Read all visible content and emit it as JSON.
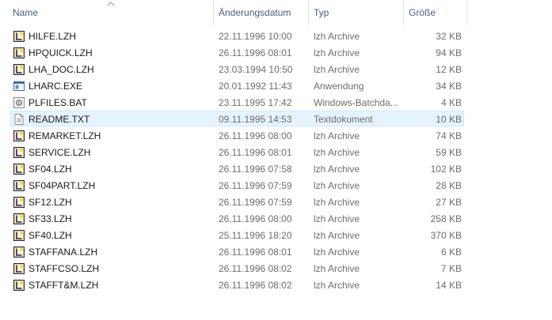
{
  "columns": {
    "name": "Name",
    "date": "Änderungsdatum",
    "type": "Typ",
    "size": "Größe"
  },
  "files": [
    {
      "name": "HILFE.LZH",
      "date": "22.11.1996 10:00",
      "type": "lzh Archive",
      "size": "32 KB",
      "icon": "archive-icon"
    },
    {
      "name": "HPQUICK.LZH",
      "date": "26.11.1996 08:01",
      "type": "lzh Archive",
      "size": "94 KB",
      "icon": "archive-icon"
    },
    {
      "name": "LHA_DOC.LZH",
      "date": "23.03.1994 10:50",
      "type": "lzh Archive",
      "size": "12 KB",
      "icon": "archive-icon"
    },
    {
      "name": "LHARC.EXE",
      "date": "20.01.1992 11:43",
      "type": "Anwendung",
      "size": "34 KB",
      "icon": "application-icon"
    },
    {
      "name": "PLFILES.BAT",
      "date": "23.11.1995 17:42",
      "type": "Windows-Batchda...",
      "size": "4 KB",
      "icon": "batch-file-icon"
    },
    {
      "name": "README.TXT",
      "date": "09.11.1995 14:53",
      "type": "Textdokument",
      "size": "10 KB",
      "icon": "text-document-icon",
      "selected": true
    },
    {
      "name": "REMARKET.LZH",
      "date": "26.11.1996 08:00",
      "type": "lzh Archive",
      "size": "74 KB",
      "icon": "archive-icon"
    },
    {
      "name": "SERVICE.LZH",
      "date": "26.11.1996 08:01",
      "type": "lzh Archive",
      "size": "59 KB",
      "icon": "archive-icon"
    },
    {
      "name": "SF04.LZH",
      "date": "26.11.1996 07:58",
      "type": "lzh Archive",
      "size": "102 KB",
      "icon": "archive-icon"
    },
    {
      "name": "SF04PART.LZH",
      "date": "26.11.1996 07:59",
      "type": "lzh Archive",
      "size": "28 KB",
      "icon": "archive-icon"
    },
    {
      "name": "SF12.LZH",
      "date": "26.11.1996 07:59",
      "type": "lzh Archive",
      "size": "27 KB",
      "icon": "archive-icon"
    },
    {
      "name": "SF33.LZH",
      "date": "26.11.1996 08:00",
      "type": "lzh Archive",
      "size": "258 KB",
      "icon": "archive-icon"
    },
    {
      "name": "SF40.LZH",
      "date": "25.11.1996 18:20",
      "type": "lzh Archive",
      "size": "370 KB",
      "icon": "archive-icon"
    },
    {
      "name": "STAFFANA.LZH",
      "date": "26.11.1996 08:01",
      "type": "lzh Archive",
      "size": "6 KB",
      "icon": "archive-icon"
    },
    {
      "name": "STAFFCSO.LZH",
      "date": "26.11.1996 08:02",
      "type": "lzh Archive",
      "size": "7 KB",
      "icon": "archive-icon"
    },
    {
      "name": "STAFFT&M.LZH",
      "date": "26.11.1996 08:02",
      "type": "lzh Archive",
      "size": "14 KB",
      "icon": "archive-icon"
    }
  ]
}
